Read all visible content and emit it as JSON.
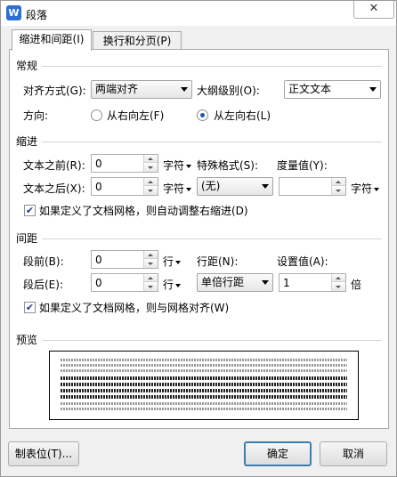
{
  "window": {
    "title": "段落",
    "app_icon": "W",
    "close_glyph": "✕"
  },
  "tabs": [
    {
      "label": "缩进和间距(I)",
      "active": true
    },
    {
      "label": "换行和分页(P)",
      "active": false
    }
  ],
  "general": {
    "heading": "常规",
    "alignment_label": "对齐方式(G):",
    "alignment_value": "两端对齐",
    "outline_label": "大纲级别(O):",
    "outline_value": "正文文本",
    "direction_label": "方向:",
    "rtl_label": "从右向左(F)",
    "ltr_label": "从左向右(L)",
    "direction_selected": "ltr"
  },
  "indent": {
    "heading": "缩进",
    "before_label": "文本之前(R):",
    "before_value": "0",
    "before_unit": "字符",
    "after_label": "文本之后(X):",
    "after_value": "0",
    "after_unit": "字符",
    "special_label": "特殊格式(S):",
    "special_value": "(无)",
    "amount_label": "度量值(Y):",
    "amount_value": "",
    "amount_unit": "字符",
    "grid_check_label": "如果定义了文档网格，则自动调整右缩进(D)",
    "grid_checked": true
  },
  "spacing": {
    "heading": "间距",
    "before_label": "段前(B):",
    "before_value": "0",
    "before_unit": "行",
    "after_label": "段后(E):",
    "after_value": "0",
    "after_unit": "行",
    "line_label": "行距(N):",
    "line_value": "单倍行距",
    "setting_label": "设置值(A):",
    "setting_value": "1",
    "setting_unit": "倍",
    "grid_check_label": "如果定义了文档网格，则与网格对齐(W)",
    "grid_checked": true
  },
  "preview": {
    "heading": "预览"
  },
  "buttons": {
    "tabs": "制表位(T)...",
    "ok": "确定",
    "cancel": "取消"
  },
  "colors": {
    "accent": "#2b6fd6",
    "default_button_border": "#3c7fb1"
  },
  "icons": {
    "check": "✔"
  }
}
